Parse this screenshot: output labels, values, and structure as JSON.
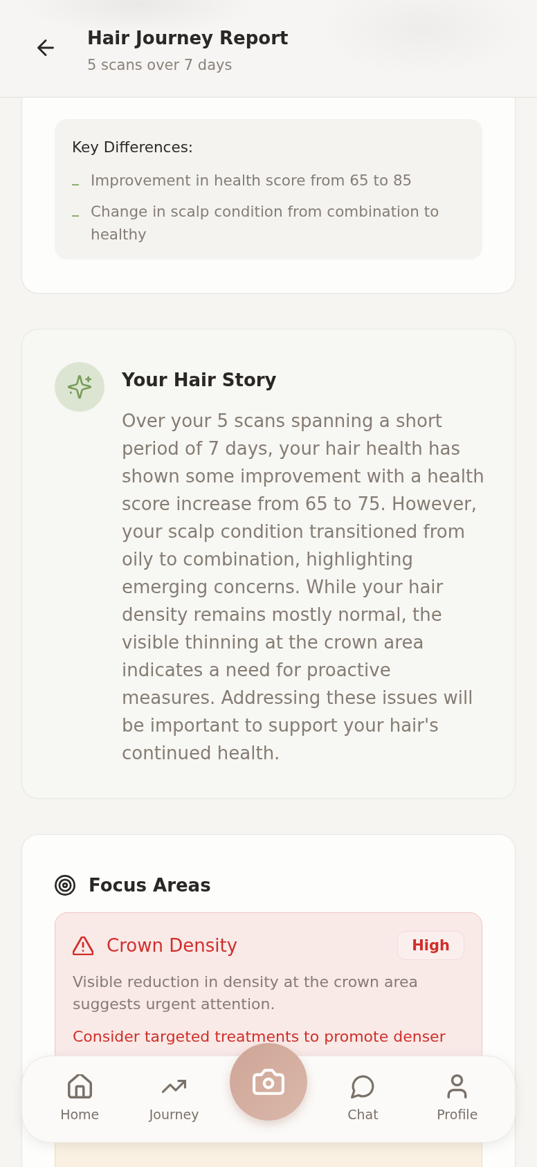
{
  "header": {
    "title": "Hair Journey Report",
    "subtitle": "5 scans over 7 days"
  },
  "comparison": {
    "key_differences": {
      "title": "Key Differences:",
      "items": [
        "Improvement in health score from 65 to 85",
        "Change in scalp condition from combination to healthy"
      ]
    }
  },
  "hair_story": {
    "title": "Your Hair Story",
    "text": "Over your 5 scans spanning a short period of 7 days, your hair health has shown some improvement with a health score increase from 65 to 75. However, your scalp condition transitioned from oily to combination, highlighting emerging concerns. While your hair density remains mostly normal, the visible thinning at the crown area indicates a need for proactive measures. Addressing these issues will be important to support your hair's continued health."
  },
  "focus_areas": {
    "title": "Focus Areas",
    "items": [
      {
        "kind": "urgent",
        "title": "Crown Density",
        "badge": "High",
        "description": "Visible reduction in density at the crown area suggests urgent attention.",
        "recommendation": "Consider targeted treatments to promote denser"
      },
      {
        "kind": "caution"
      }
    ]
  },
  "nav": {
    "items": [
      {
        "label": "Home",
        "selected": false
      },
      {
        "label": "Journey",
        "selected": false
      },
      {
        "label": "Chat",
        "selected": false
      },
      {
        "label": "Profile",
        "selected": false
      }
    ]
  }
}
